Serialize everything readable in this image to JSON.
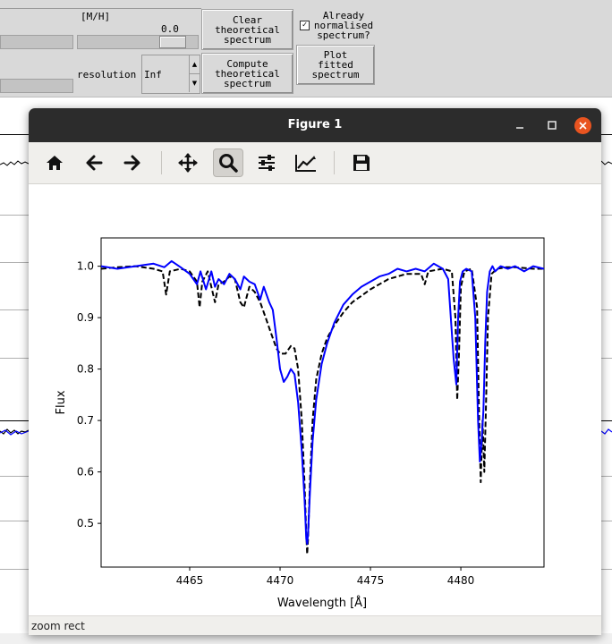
{
  "background_app": {
    "metallicity_label": "[M/H]",
    "metallicity_value": "0.0",
    "resolution_label": "resolution",
    "resolution_value": "Inf",
    "clear_button": [
      "Clear",
      "theoretical",
      "spectrum"
    ],
    "compute_button": [
      "Compute",
      "theoretical",
      "spectrum"
    ],
    "plot_button": [
      "Plot",
      "fitted",
      "spectrum"
    ],
    "normalised_check": {
      "checked": true,
      "label": [
        "Already",
        "normalised",
        "spectrum?"
      ]
    }
  },
  "window": {
    "title": "Figure 1",
    "minimize_icon": "minimize-icon",
    "maximize_icon": "maximize-icon",
    "close_icon": "close-icon"
  },
  "toolbar": {
    "tools": [
      {
        "name": "home",
        "icon": "home-icon"
      },
      {
        "name": "back",
        "icon": "arrow-left-icon"
      },
      {
        "name": "forward",
        "icon": "arrow-right-icon"
      },
      {
        "name": "pan",
        "icon": "move-icon"
      },
      {
        "name": "zoom",
        "icon": "magnifier-icon",
        "active": true
      },
      {
        "name": "subplots",
        "icon": "sliders-icon"
      },
      {
        "name": "edit-axis",
        "icon": "line-chart-icon"
      },
      {
        "name": "save",
        "icon": "floppy-icon"
      }
    ]
  },
  "status": {
    "text": "zoom rect"
  },
  "chart_data": {
    "type": "line",
    "xlabel": "Wavelength [Å]",
    "ylabel": "Flux",
    "xlim": [
      4460.1,
      4484.6
    ],
    "ylim": [
      0.415,
      1.055
    ],
    "xticks": [
      4465,
      4470,
      4475,
      4480
    ],
    "yticks": [
      0.5,
      0.6,
      0.7,
      0.8,
      0.9,
      1.0
    ],
    "xtick_labels": [
      "4465",
      "4470",
      "4475",
      "4480"
    ],
    "ytick_labels": [
      "0.5",
      "0.6",
      "0.7",
      "0.8",
      "0.9",
      "1.0"
    ],
    "grid": false,
    "legend": null,
    "series": [
      {
        "style": "solid",
        "color": "#0000ff",
        "x": [
          4460.1,
          4461.0,
          4462.0,
          4463.0,
          4463.6,
          4464.0,
          4464.5,
          4465.0,
          4465.4,
          4465.6,
          4465.9,
          4466.2,
          4466.4,
          4466.6,
          4466.9,
          4467.2,
          4467.5,
          4467.8,
          4468.0,
          4468.3,
          4468.6,
          4468.9,
          4469.1,
          4469.4,
          4469.6,
          4469.8,
          4470.0,
          4470.2,
          4470.4,
          4470.6,
          4470.8,
          4471.0,
          4471.2,
          4471.35,
          4471.45,
          4471.5,
          4471.55,
          4471.65,
          4471.8,
          4472.0,
          4472.3,
          4472.6,
          4473.0,
          4473.5,
          4474.0,
          4474.5,
          4475.0,
          4475.5,
          4476.0,
          4476.5,
          4477.0,
          4477.5,
          4478.0,
          4478.5,
          4479.0,
          4479.3,
          4479.6,
          4479.75,
          4479.85,
          4479.95,
          4480.1,
          4480.3,
          4480.6,
          4480.8,
          4480.95,
          4481.05,
          4481.15,
          4481.25,
          4481.35,
          4481.45,
          4481.6,
          4481.75,
          4481.9,
          4482.2,
          4482.6,
          4483.0,
          4483.5,
          4484.0,
          4484.6
        ],
        "y": [
          1.0,
          0.995,
          1.0,
          1.005,
          0.998,
          1.01,
          0.998,
          0.985,
          0.965,
          0.99,
          0.955,
          0.99,
          0.96,
          0.975,
          0.965,
          0.985,
          0.975,
          0.955,
          0.98,
          0.97,
          0.965,
          0.935,
          0.96,
          0.93,
          0.915,
          0.86,
          0.8,
          0.775,
          0.785,
          0.8,
          0.79,
          0.735,
          0.64,
          0.55,
          0.47,
          0.46,
          0.48,
          0.56,
          0.66,
          0.74,
          0.81,
          0.85,
          0.89,
          0.925,
          0.945,
          0.96,
          0.97,
          0.98,
          0.985,
          0.995,
          0.99,
          0.995,
          0.99,
          1.005,
          0.995,
          0.975,
          0.82,
          0.77,
          0.9,
          0.97,
          0.99,
          0.995,
          0.99,
          0.9,
          0.7,
          0.62,
          0.66,
          0.72,
          0.85,
          0.95,
          0.99,
          1.0,
          0.99,
          1.0,
          0.995,
          1.0,
          0.99,
          1.0,
          0.995
        ]
      },
      {
        "style": "dashed",
        "color": "#000000",
        "x": [
          4460.1,
          4461.0,
          4462.0,
          4463.0,
          4463.5,
          4463.7,
          4463.9,
          4464.5,
          4465.0,
          4465.4,
          4465.55,
          4465.7,
          4466.0,
          4466.2,
          4466.4,
          4466.6,
          4466.9,
          4467.2,
          4467.5,
          4467.8,
          4468.0,
          4468.3,
          4468.6,
          4468.9,
          4469.2,
          4469.5,
          4469.8,
          4470.0,
          4470.3,
          4470.6,
          4470.8,
          4471.0,
          4471.2,
          4471.35,
          4471.45,
          4471.5,
          4471.55,
          4471.65,
          4471.8,
          4472.0,
          4472.3,
          4472.6,
          4473.0,
          4473.5,
          4474.0,
          4475.0,
          4476.0,
          4477.0,
          4477.8,
          4478.0,
          4478.2,
          4479.0,
          4479.5,
          4479.7,
          4479.8,
          4479.9,
          4480.0,
          4480.2,
          4480.6,
          4480.9,
          4481.0,
          4481.1,
          4481.2,
          4481.3,
          4481.4,
          4481.5,
          4481.7,
          4482.0,
          4482.5,
          4483.0,
          4484.0,
          4484.6
        ],
        "y": [
          0.995,
          0.998,
          1.0,
          0.995,
          0.99,
          0.945,
          0.99,
          0.995,
          0.99,
          0.97,
          0.92,
          0.97,
          0.99,
          0.96,
          0.93,
          0.965,
          0.97,
          0.98,
          0.975,
          0.93,
          0.92,
          0.96,
          0.95,
          0.93,
          0.9,
          0.87,
          0.84,
          0.83,
          0.83,
          0.845,
          0.84,
          0.8,
          0.7,
          0.58,
          0.48,
          0.44,
          0.47,
          0.58,
          0.7,
          0.78,
          0.83,
          0.86,
          0.885,
          0.91,
          0.93,
          0.955,
          0.975,
          0.985,
          0.985,
          0.965,
          0.99,
          0.995,
          0.99,
          0.9,
          0.74,
          0.83,
          0.96,
          0.99,
          0.995,
          0.92,
          0.72,
          0.58,
          0.7,
          0.6,
          0.74,
          0.9,
          0.985,
          0.995,
          0.998,
          0.998,
          0.995,
          0.995
        ]
      }
    ]
  }
}
